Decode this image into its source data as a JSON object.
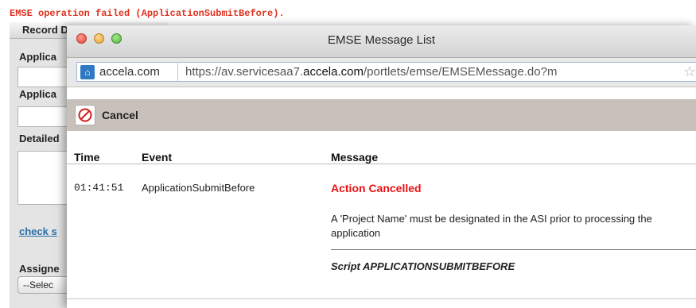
{
  "background": {
    "error_text": "EMSE operation failed (ApplicationSubmitBefore).",
    "tab_label": "Record Det",
    "labels": [
      "Applica",
      "Applica",
      "Detailed"
    ],
    "link_text": "check s",
    "assigned_label": "Assigne",
    "select_value": "--Selec"
  },
  "window": {
    "title": "EMSE Message List",
    "site_name": "accela.com",
    "url_prefix": "https://av.servicesaa7.",
    "url_domain": "accela.com",
    "url_suffix": "/portlets/emse/EMSEMessage.do?m"
  },
  "toolbar": {
    "cancel_label": "Cancel"
  },
  "table": {
    "headers": {
      "time": "Time",
      "event": "Event",
      "message": "Message"
    },
    "rows": [
      {
        "time": "01:41:51",
        "event": "ApplicationSubmitBefore",
        "status": "Action Cancelled",
        "description": "A 'Project Name' must be designated in the ASI prior to processing the application",
        "script": "Script  APPLICATIONSUBMITBEFORE"
      }
    ]
  },
  "colors": {
    "error_red": "#e81212",
    "toolbar_bg": "#c8c1bb",
    "link_blue": "#2a6fa8"
  },
  "icons": [
    "cancel-icon",
    "site-icon",
    "star-icon",
    "close-light-icon",
    "minimize-light-icon",
    "zoom-light-icon"
  ]
}
